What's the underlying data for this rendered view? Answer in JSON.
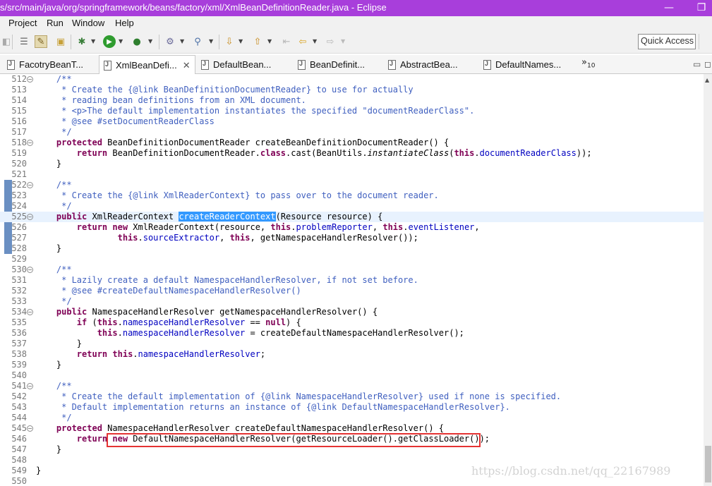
{
  "window": {
    "title": "s/src/main/java/org/springframework/beans/factory/xml/XmlBeanDefinitionReader.java - Eclipse",
    "minimize": "—",
    "restore": "❐"
  },
  "menu": [
    "Project",
    "Run",
    "Window",
    "Help"
  ],
  "toolbar": {
    "quick_access": "Quick Access",
    "icons": [
      "toggle-view-icon",
      "mark-occurrences-icon",
      "new-package-icon",
      "debug-icon",
      "run-icon",
      "run-external-tool-icon",
      "open-type-icon",
      "search-icon",
      "next-annotation-icon",
      "previous-annotation-icon",
      "last-edit-icon",
      "back-icon",
      "forward-icon"
    ]
  },
  "tabs": [
    {
      "label": "FacotryBeanT...",
      "active": false
    },
    {
      "label": "XmlBeanDefi...",
      "active": true
    },
    {
      "label": "DefaultBean...",
      "active": false
    },
    {
      "label": "BeanDefinit...",
      "active": false
    },
    {
      "label": "AbstractBea...",
      "active": false
    },
    {
      "label": "DefaultNames...",
      "active": false
    }
  ],
  "tab_overflow": {
    "symbol": "»",
    "count": "10"
  },
  "editor": {
    "selected_text": "createReaderContext",
    "highlighted_line": "525",
    "boxed_line": "546",
    "lines": [
      {
        "n": "512",
        "fold": true,
        "text": "    /**"
      },
      {
        "n": "513",
        "fold": false,
        "text": "     * Create the {@link BeanDefinitionDocumentReader} to use for actually"
      },
      {
        "n": "514",
        "fold": false,
        "text": "     * reading bean definitions from an XML document."
      },
      {
        "n": "515",
        "fold": false,
        "text": "     * <p>The default implementation instantiates the specified \"documentReaderClass\"."
      },
      {
        "n": "516",
        "fold": false,
        "text": "     * @see #setDocumentReaderClass"
      },
      {
        "n": "517",
        "fold": false,
        "text": "     */"
      },
      {
        "n": "518",
        "fold": true,
        "text": "    protected BeanDefinitionDocumentReader createBeanDefinitionDocumentReader() {"
      },
      {
        "n": "519",
        "fold": false,
        "text": "        return BeanDefinitionDocumentReader.class.cast(BeanUtils.instantiateClass(this.documentReaderClass));"
      },
      {
        "n": "520",
        "fold": false,
        "text": "    }"
      },
      {
        "n": "521",
        "fold": false,
        "text": ""
      },
      {
        "n": "522",
        "fold": true,
        "text": "    /**"
      },
      {
        "n": "523",
        "fold": false,
        "text": "     * Create the {@link XmlReaderContext} to pass over to the document reader."
      },
      {
        "n": "524",
        "fold": false,
        "text": "     */"
      },
      {
        "n": "525",
        "fold": true,
        "text": "    public XmlReaderContext createReaderContext(Resource resource) {"
      },
      {
        "n": "526",
        "fold": false,
        "text": "        return new XmlReaderContext(resource, this.problemReporter, this.eventListener,"
      },
      {
        "n": "527",
        "fold": false,
        "text": "                this.sourceExtractor, this, getNamespaceHandlerResolver());"
      },
      {
        "n": "528",
        "fold": false,
        "text": "    }"
      },
      {
        "n": "529",
        "fold": false,
        "text": ""
      },
      {
        "n": "530",
        "fold": true,
        "text": "    /**"
      },
      {
        "n": "531",
        "fold": false,
        "text": "     * Lazily create a default NamespaceHandlerResolver, if not set before."
      },
      {
        "n": "532",
        "fold": false,
        "text": "     * @see #createDefaultNamespaceHandlerResolver()"
      },
      {
        "n": "533",
        "fold": false,
        "text": "     */"
      },
      {
        "n": "534",
        "fold": true,
        "text": "    public NamespaceHandlerResolver getNamespaceHandlerResolver() {"
      },
      {
        "n": "535",
        "fold": false,
        "text": "        if (this.namespaceHandlerResolver == null) {"
      },
      {
        "n": "536",
        "fold": false,
        "text": "            this.namespaceHandlerResolver = createDefaultNamespaceHandlerResolver();"
      },
      {
        "n": "537",
        "fold": false,
        "text": "        }"
      },
      {
        "n": "538",
        "fold": false,
        "text": "        return this.namespaceHandlerResolver;"
      },
      {
        "n": "539",
        "fold": false,
        "text": "    }"
      },
      {
        "n": "540",
        "fold": false,
        "text": ""
      },
      {
        "n": "541",
        "fold": true,
        "text": "    /**"
      },
      {
        "n": "542",
        "fold": false,
        "text": "     * Create the default implementation of {@link NamespaceHandlerResolver} used if none is specified."
      },
      {
        "n": "543",
        "fold": false,
        "text": "     * Default implementation returns an instance of {@link DefaultNamespaceHandlerResolver}."
      },
      {
        "n": "544",
        "fold": false,
        "text": "     */"
      },
      {
        "n": "545",
        "fold": true,
        "text": "    protected NamespaceHandlerResolver createDefaultNamespaceHandlerResolver() {"
      },
      {
        "n": "546",
        "fold": false,
        "text": "        return new DefaultNamespaceHandlerResolver(getResourceLoader().getClassLoader());"
      },
      {
        "n": "547",
        "fold": false,
        "text": "    }"
      },
      {
        "n": "548",
        "fold": false,
        "text": ""
      },
      {
        "n": "549",
        "fold": false,
        "text": "}"
      },
      {
        "n": "550",
        "fold": false,
        "text": ""
      }
    ]
  },
  "watermark": "https://blog.csdn.net/qq_22167989",
  "colors": {
    "titlebar": "#a83edb",
    "keyword": "#7f0055",
    "javadoc": "#3f5fbf",
    "field": "#0000c0",
    "selection": "#3399ff",
    "current_line": "#e8f2fe",
    "annotation_box": "#e53333"
  }
}
